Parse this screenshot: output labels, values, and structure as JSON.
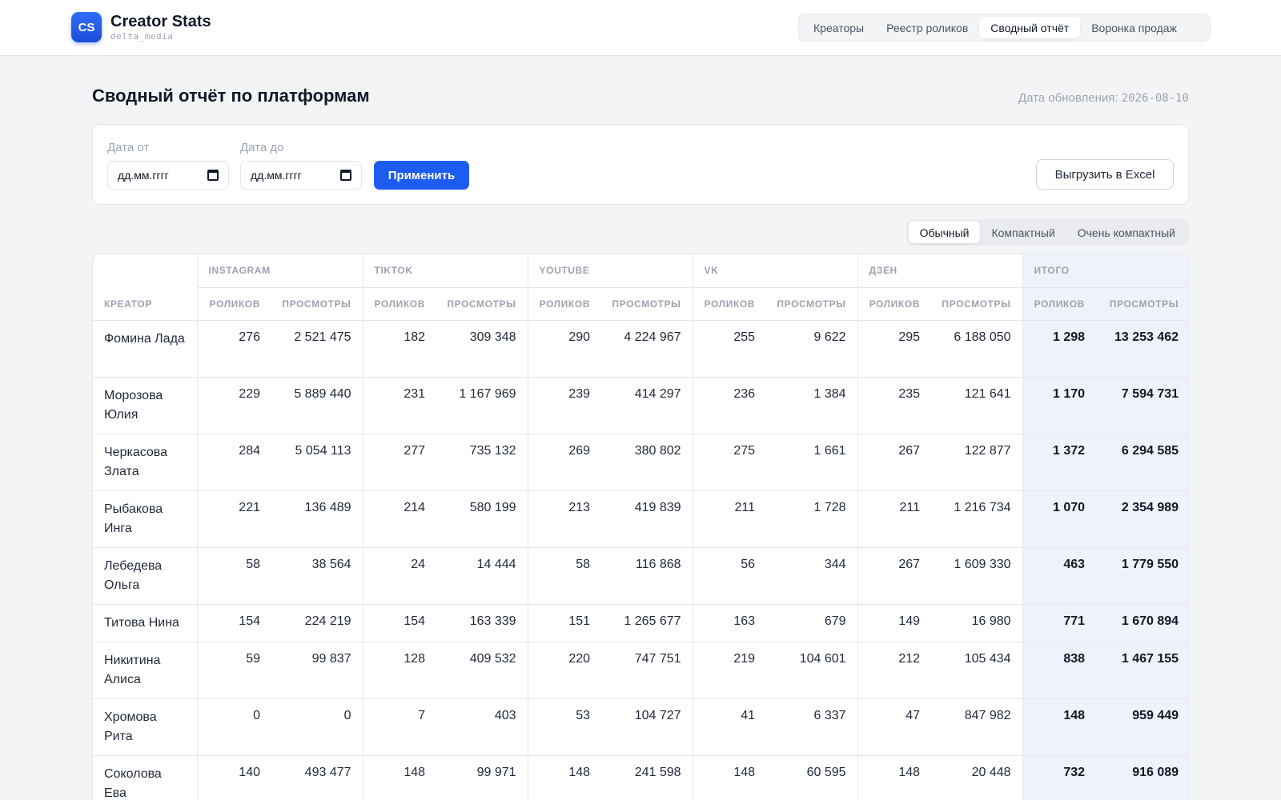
{
  "app": {
    "logo_text": "CS",
    "title": "Creator Stats",
    "subtitle": "delta_media"
  },
  "nav": [
    {
      "label": "Креаторы",
      "active": false
    },
    {
      "label": "Реестр роликов",
      "active": false
    },
    {
      "label": "Сводный отчёт",
      "active": true
    },
    {
      "label": "Воронка продаж",
      "active": false
    }
  ],
  "header": {
    "title": "Сводный отчёт по платформам",
    "updated_label": "Дата обновления:",
    "updated_value": "2026-08-10"
  },
  "filters": {
    "from_label": "Дата от",
    "from_placeholder": "дд.мм.гггг",
    "to_label": "Дата до",
    "to_placeholder": "дд.мм.гггг",
    "apply_label": "Применить",
    "export_label": "Выгрузить в Excel"
  },
  "density": [
    {
      "label": "Обычный",
      "active": true
    },
    {
      "label": "Компактный",
      "active": false
    },
    {
      "label": "Очень компактный",
      "active": false
    }
  ],
  "table": {
    "creator_header": "КРЕАТОР",
    "groups": [
      "INSTAGRAM",
      "TIKTOK",
      "YOUTUBE",
      "VK",
      "ДЗЕН",
      "ИТОГО"
    ],
    "sub_headers": [
      "РОЛИКОВ",
      "ПРОСМОТРЫ"
    ],
    "rows": [
      {
        "name": "Фомина Лада",
        "cells": [
          "276",
          "2 521 475",
          "182",
          "309 348",
          "290",
          "4 224 967",
          "255",
          "9 622",
          "295",
          "6 188 050",
          "1 298",
          "13 253 462"
        ]
      },
      {
        "name": "Морозова Юлия",
        "cells": [
          "229",
          "5 889 440",
          "231",
          "1 167 969",
          "239",
          "414 297",
          "236",
          "1 384",
          "235",
          "121 641",
          "1 170",
          "7 594 731"
        ]
      },
      {
        "name": "Черкасова Злата",
        "cells": [
          "284",
          "5 054 113",
          "277",
          "735 132",
          "269",
          "380 802",
          "275",
          "1 661",
          "267",
          "122 877",
          "1 372",
          "6 294 585"
        ]
      },
      {
        "name": "Рыбакова Инга",
        "cells": [
          "221",
          "136 489",
          "214",
          "580 199",
          "213",
          "419 839",
          "211",
          "1 728",
          "211",
          "1 216 734",
          "1 070",
          "2 354 989"
        ]
      },
      {
        "name": "Лебедева Ольга",
        "cells": [
          "58",
          "38 564",
          "24",
          "14 444",
          "58",
          "116 868",
          "56",
          "344",
          "267",
          "1 609 330",
          "463",
          "1 779 550"
        ]
      },
      {
        "name": "Титова Нина",
        "cells": [
          "154",
          "224 219",
          "154",
          "163 339",
          "151",
          "1 265 677",
          "163",
          "679",
          "149",
          "16 980",
          "771",
          "1 670 894"
        ]
      },
      {
        "name": "Никитина Алиса",
        "cells": [
          "59",
          "99 837",
          "128",
          "409 532",
          "220",
          "747 751",
          "219",
          "104 601",
          "212",
          "105 434",
          "838",
          "1 467 155"
        ]
      },
      {
        "name": "Хромова Рита",
        "cells": [
          "0",
          "0",
          "7",
          "403",
          "53",
          "104 727",
          "41",
          "6 337",
          "47",
          "847 982",
          "148",
          "959 449"
        ]
      },
      {
        "name": "Соколова Ева",
        "cells": [
          "140",
          "493 477",
          "148",
          "99 971",
          "148",
          "241 598",
          "148",
          "60 595",
          "148",
          "20 448",
          "732",
          "916 089"
        ]
      }
    ]
  }
}
